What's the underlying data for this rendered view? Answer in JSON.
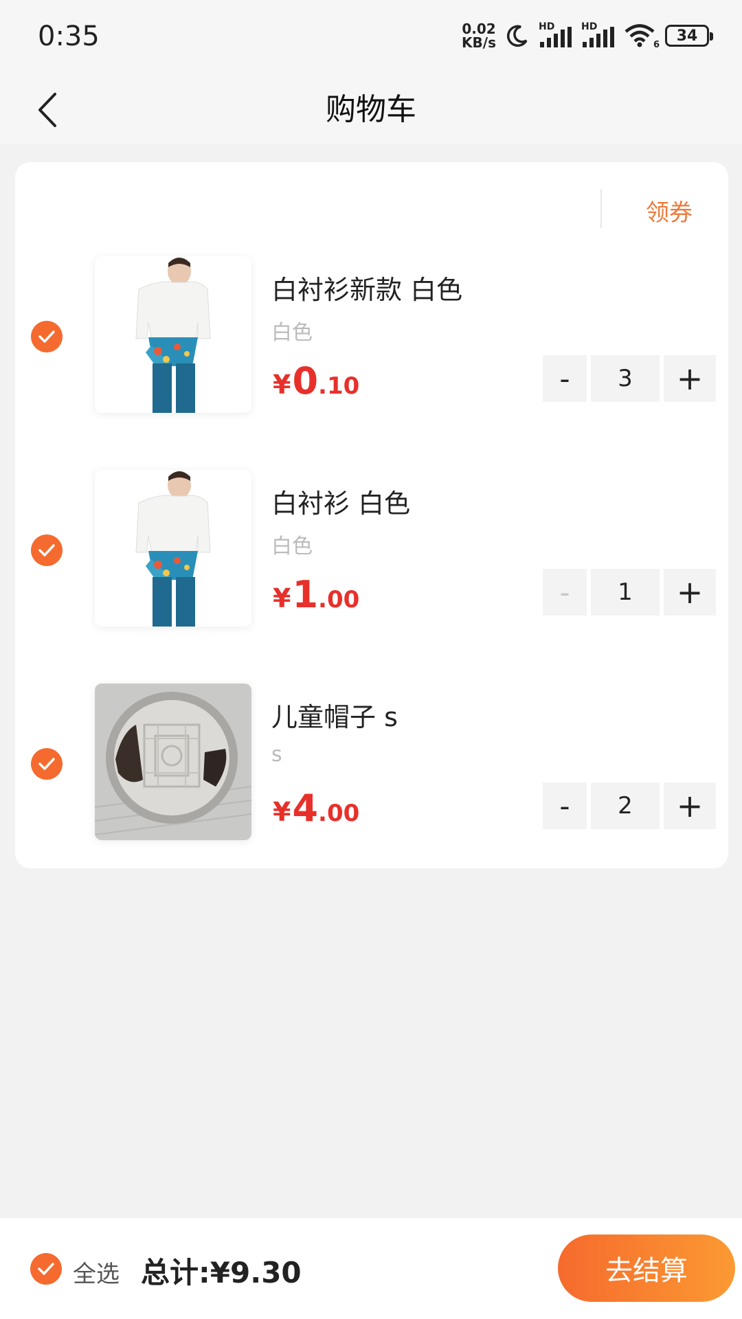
{
  "status_bar": {
    "time": "0:35",
    "net_speed_value": "0.02",
    "net_speed_unit": "KB/s",
    "hd1": "HD",
    "hd2": "HD",
    "wifi_sub": "6",
    "battery": "34"
  },
  "header": {
    "title": "购物车"
  },
  "cart": {
    "coupon_label": "领券",
    "items": [
      {
        "name": "白衬衫新款 白色",
        "spec": "白色",
        "price_symbol": "¥",
        "price_int": "0",
        "price_dec": ".10",
        "quantity": "3",
        "minus": "-",
        "plus": "+",
        "minus_enabled": true,
        "image_icon": "shirt-product-photo"
      },
      {
        "name": "白衬衫 白色",
        "spec": "白色",
        "price_symbol": "¥",
        "price_int": "1",
        "price_dec": ".00",
        "quantity": "1",
        "minus": "-",
        "plus": "+",
        "minus_enabled": false,
        "image_icon": "shirt-product-photo"
      },
      {
        "name": "儿童帽子 s",
        "spec": "s",
        "price_symbol": "¥",
        "price_int": "4",
        "price_dec": ".00",
        "quantity": "2",
        "minus": "-",
        "plus": "+",
        "minus_enabled": true,
        "image_icon": "manhole-cover-photo"
      }
    ]
  },
  "footer": {
    "select_all_label": "全选",
    "total_text": "总计:¥9.30",
    "checkout_label": "去结算"
  },
  "colors": {
    "accent": "#f56a2e",
    "price": "#e8302b",
    "coupon": "#ee7a3c"
  }
}
